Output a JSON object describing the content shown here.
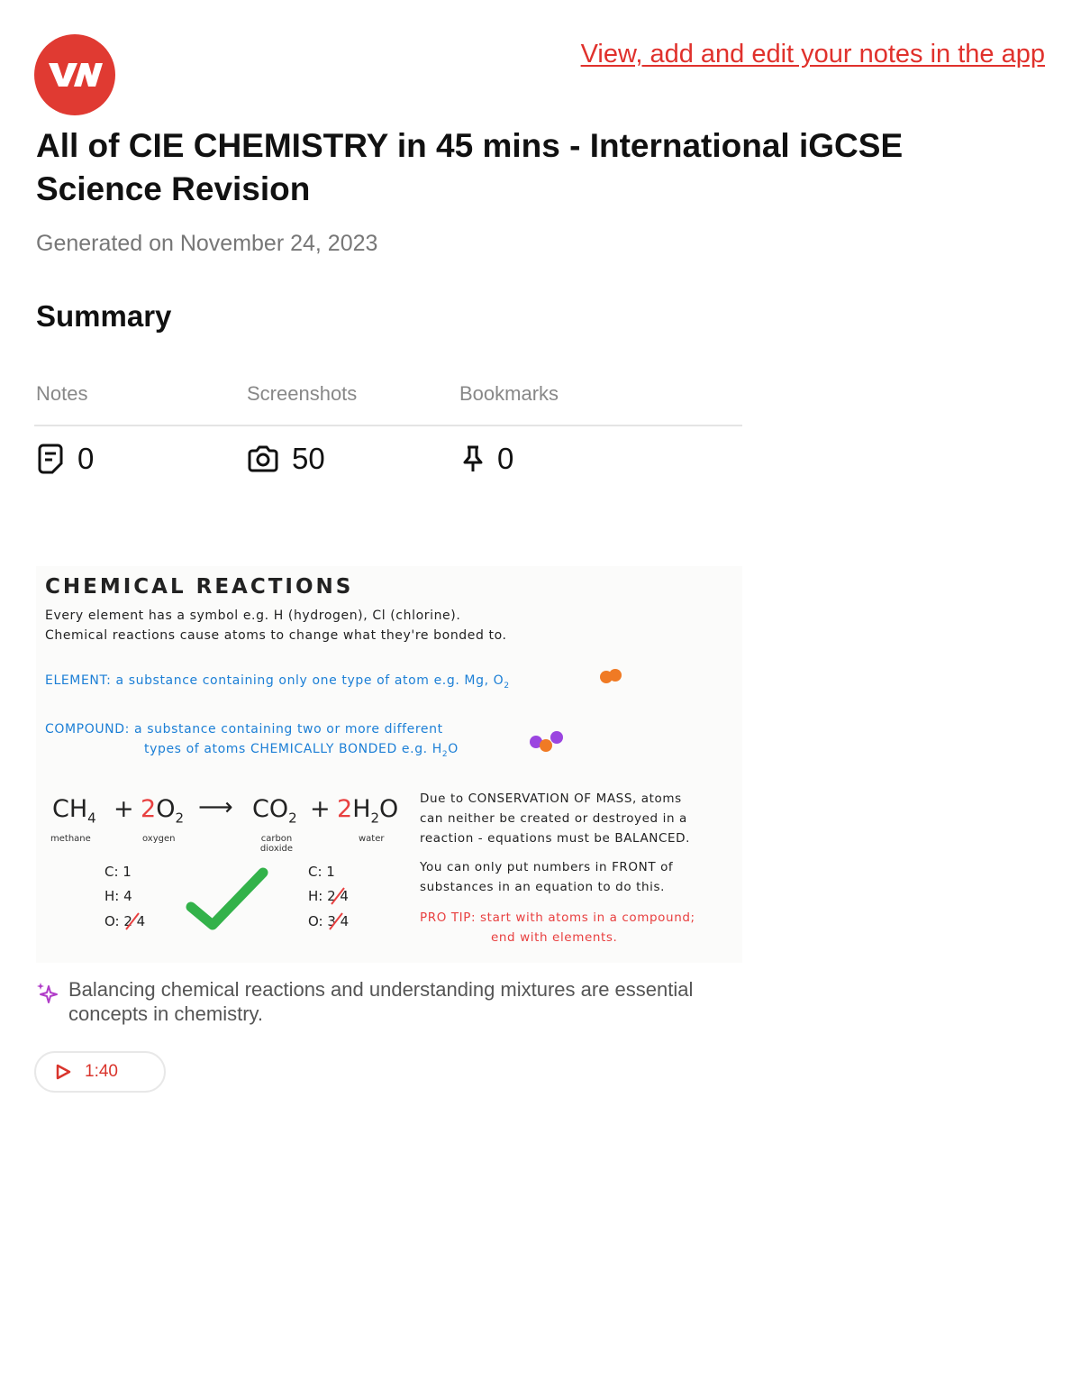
{
  "header": {
    "logo_text": "VN",
    "app_link": "View, add and edit your notes in the app",
    "title": "All of CIE CHEMISTRY in 45 mins - International iGCSE Science Revision",
    "generated": "Generated on November 24, 2023"
  },
  "summary": {
    "heading": "Summary",
    "stats": [
      {
        "label": "Notes",
        "value": "0",
        "icon": "note-icon"
      },
      {
        "label": "Screenshots",
        "value": "50",
        "icon": "camera-icon"
      },
      {
        "label": "Bookmarks",
        "value": "0",
        "icon": "pin-icon"
      }
    ]
  },
  "screenshot": {
    "heading": "CHEMICAL REACTIONS",
    "line1": "Every element has a symbol e.g. H (hydrogen), Cl (chlorine).",
    "line2": "Chemical reactions cause atoms to change what they're bonded to.",
    "element": "ELEMENT: a substance containing only one type of atom e.g. Mg, O",
    "compound1": "COMPOUND: a substance containing two or more different",
    "compound2": "types of atoms CHEMICALLY BONDED e.g. H",
    "compound2_end": "O",
    "equation": {
      "plus": "+",
      "arrow": "⟶",
      "coef": "2"
    },
    "labels": [
      "methane",
      "oxygen",
      "carbon dioxide",
      "water"
    ],
    "left_counts": [
      "C: 1",
      "H: 4",
      "O: 2 4"
    ],
    "right_counts": [
      "C: 1",
      "H: 2 4",
      "O: 3 4"
    ],
    "right1": "Due to CONSERVATION OF MASS, atoms",
    "right2": "can neither be created or destroyed in a",
    "right3": "reaction - equations must be BALANCED.",
    "right4": "You can only put numbers in FRONT of",
    "right5": "substances in an equation to do this.",
    "tip1": "PRO TIP: start with atoms in a compound;",
    "tip2": "end with elements."
  },
  "insight": "Balancing chemical reactions and understanding mixtures are essential concepts in chemistry.",
  "timestamp": "1:40",
  "colors": {
    "brand": "#e03a32",
    "accent_blue": "#1c7fd6",
    "check_green": "#33b24a",
    "ai_purple": "#b03cc8"
  }
}
